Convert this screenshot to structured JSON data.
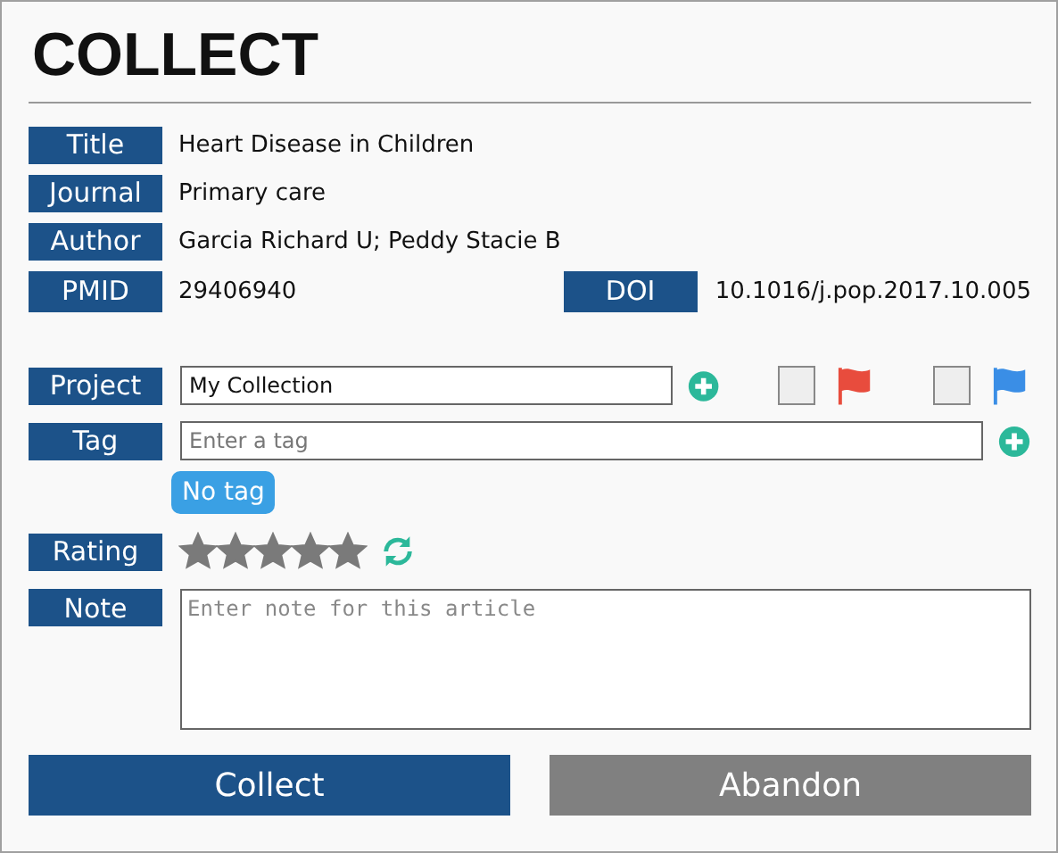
{
  "heading": "COLLECT",
  "fields": [
    {
      "label": "Title",
      "value": "Heart Disease in Children"
    },
    {
      "label": "Journal",
      "value": "Primary care"
    },
    {
      "label": "Author",
      "value": "Garcia Richard U; Peddy Stacie B"
    }
  ],
  "pmid": {
    "label": "PMID",
    "value": "29406940"
  },
  "doi": {
    "label": "DOI",
    "value": "10.1016/j.pop.2017.10.005"
  },
  "project": {
    "label": "Project",
    "value": "My Collection",
    "flags": [
      {
        "checked": false,
        "color": "#e84c3d"
      },
      {
        "checked": false,
        "color": "#3a8ee6"
      }
    ]
  },
  "tag": {
    "label": "Tag",
    "placeholder": "Enter a tag",
    "chips": [
      "No tag"
    ]
  },
  "rating": {
    "label": "Rating",
    "stars": 5
  },
  "note": {
    "label": "Note",
    "placeholder": "Enter note for this article"
  },
  "buttons": [
    {
      "label": "Collect",
      "kind": "primary"
    },
    {
      "label": "Abandon",
      "kind": "secondary"
    }
  ]
}
